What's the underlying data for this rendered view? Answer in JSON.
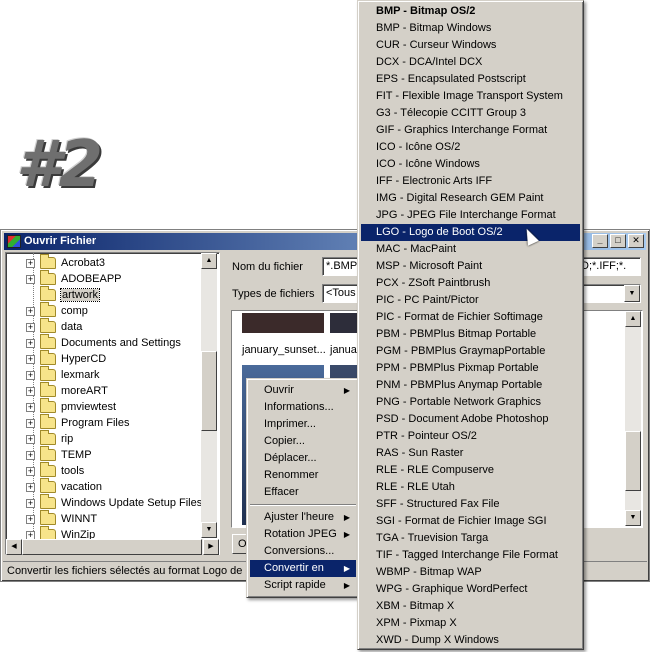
{
  "badge": "#2",
  "window": {
    "title": "Ouvrir Fichier",
    "buttons": [
      "_",
      "□",
      "✕"
    ]
  },
  "tree": {
    "items": [
      {
        "label": "Acrobat3",
        "expandable": true
      },
      {
        "label": "ADOBEAPP",
        "expandable": true
      },
      {
        "label": "artwork",
        "expandable": false,
        "selected": true
      },
      {
        "label": "comp",
        "expandable": true
      },
      {
        "label": "data",
        "expandable": true
      },
      {
        "label": "Documents and Settings",
        "expandable": true
      },
      {
        "label": "HyperCD",
        "expandable": true
      },
      {
        "label": "lexmark",
        "expandable": true
      },
      {
        "label": "moreART",
        "expandable": true
      },
      {
        "label": "pmviewtest",
        "expandable": true
      },
      {
        "label": "Program Files",
        "expandable": true
      },
      {
        "label": "rip",
        "expandable": true
      },
      {
        "label": "TEMP",
        "expandable": true
      },
      {
        "label": "tools",
        "expandable": true
      },
      {
        "label": "vacation",
        "expandable": true
      },
      {
        "label": "Windows Update Setup Files",
        "expandable": true
      },
      {
        "label": "WINNT",
        "expandable": true
      },
      {
        "label": "WinZip",
        "expandable": true
      }
    ]
  },
  "fields": {
    "filename_label": "Nom du fichier",
    "filename_value": "*.BMP;",
    "filename_tail": "D;*.IFF;*.",
    "filetype_label": "Types de fichiers",
    "filetype_value": "<Tous"
  },
  "thumbnails": [
    {
      "caption": "january_sunset..."
    },
    {
      "caption": "janua"
    }
  ],
  "open_button_partial": "O",
  "status": "Convertir les fichiers sélectés au format Logo de B",
  "context_menu": {
    "items": [
      {
        "label": "Ouvrir",
        "submenu": true
      },
      {
        "label": "Informations...",
        "submenu": false
      },
      {
        "label": "Imprimer...",
        "submenu": false
      },
      {
        "label": "Copier...",
        "submenu": false
      },
      {
        "label": "Déplacer...",
        "submenu": false
      },
      {
        "label": "Renommer",
        "submenu": false
      },
      {
        "label": "Effacer",
        "submenu": false
      },
      {
        "separator": true
      },
      {
        "label": "Ajuster l'heure",
        "submenu": true
      },
      {
        "label": "Rotation JPEG",
        "submenu": true
      },
      {
        "label": "Conversions...",
        "submenu": false
      },
      {
        "label": "Convertir en",
        "submenu": true,
        "active": true
      },
      {
        "label": "Script rapide",
        "submenu": true
      }
    ]
  },
  "format_menu": {
    "items": [
      {
        "label": "BMP - Bitmap OS/2",
        "bold": true
      },
      {
        "label": "BMP - Bitmap Windows"
      },
      {
        "label": "CUR - Curseur Windows"
      },
      {
        "label": "DCX - DCA/Intel DCX"
      },
      {
        "label": "EPS - Encapsulated Postscript"
      },
      {
        "label": "FIT - Flexible Image Transport System"
      },
      {
        "label": "G3 - Télecopie CCITT Group 3"
      },
      {
        "label": "GIF - Graphics Interchange Format"
      },
      {
        "label": "ICO - Icône OS/2"
      },
      {
        "label": "ICO - Icône Windows"
      },
      {
        "label": "IFF - Electronic Arts IFF"
      },
      {
        "label": "IMG - Digital Research GEM Paint"
      },
      {
        "label": "JPG - JPEG File Interchange Format"
      },
      {
        "label": "LGO - Logo de Boot OS/2",
        "active": true
      },
      {
        "label": "MAC - MacPaint"
      },
      {
        "label": "MSP - Microsoft Paint"
      },
      {
        "label": "PCX - ZSoft Paintbrush"
      },
      {
        "label": "PIC - PC Paint/Pictor"
      },
      {
        "label": "PIC - Format de Fichier Softimage"
      },
      {
        "label": "PBM - PBMPlus Bitmap Portable"
      },
      {
        "label": "PGM - PBMPlus GraymapPortable"
      },
      {
        "label": "PPM - PBMPlus Pixmap Portable"
      },
      {
        "label": "PNM - PBMPlus Anymap Portable"
      },
      {
        "label": "PNG - Portable Network Graphics"
      },
      {
        "label": "PSD - Document Adobe Photoshop"
      },
      {
        "label": "PTR - Pointeur OS/2"
      },
      {
        "label": "RAS - Sun Raster"
      },
      {
        "label": "RLE - RLE Compuserve"
      },
      {
        "label": "RLE - RLE Utah"
      },
      {
        "label": "SFF - Structured Fax File"
      },
      {
        "label": "SGI - Format de Fichier Image SGI"
      },
      {
        "label": "TGA - Truevision Targa"
      },
      {
        "label": "TIF - Tagged Interchange File Format"
      },
      {
        "label": "WBMP - Bitmap WAP"
      },
      {
        "label": "WPG - Graphique WordPerfect"
      },
      {
        "label": "XBM - Bitmap X"
      },
      {
        "label": "XPM - Pixmap X"
      },
      {
        "label": "XWD - Dump X Windows"
      }
    ]
  }
}
